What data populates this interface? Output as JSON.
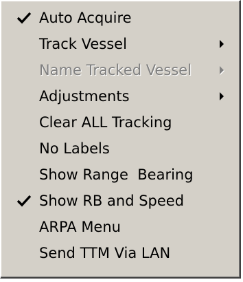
{
  "menu": {
    "items": [
      {
        "label": "Auto Acquire",
        "checked": true,
        "submenu": false,
        "disabled": false,
        "icon": "checkmark-icon"
      },
      {
        "label": "Track Vessel",
        "checked": false,
        "submenu": true,
        "disabled": false,
        "icon": "submenu-arrow-icon"
      },
      {
        "label": "Name Tracked Vessel",
        "checked": false,
        "submenu": true,
        "disabled": true,
        "icon": "submenu-arrow-icon"
      },
      {
        "label": "Adjustments",
        "checked": false,
        "submenu": true,
        "disabled": false,
        "icon": "submenu-arrow-icon"
      },
      {
        "label": "Clear ALL Tracking",
        "checked": false,
        "submenu": false,
        "disabled": false
      },
      {
        "label": "No Labels",
        "checked": false,
        "submenu": false,
        "disabled": false
      },
      {
        "label": "Show Range  Bearing",
        "checked": false,
        "submenu": false,
        "disabled": false
      },
      {
        "label": "Show RB and Speed",
        "checked": true,
        "submenu": false,
        "disabled": false,
        "icon": "checkmark-icon"
      },
      {
        "label": "ARPA Menu",
        "checked": false,
        "submenu": false,
        "disabled": false
      },
      {
        "label": "Send TTM Via LAN",
        "checked": false,
        "submenu": false,
        "disabled": false
      }
    ],
    "colors": {
      "background": "#d4d0c8",
      "text": "#000000",
      "disabled_text": "#808080",
      "highlight": "#ffffff",
      "shadow": "#404040"
    }
  }
}
